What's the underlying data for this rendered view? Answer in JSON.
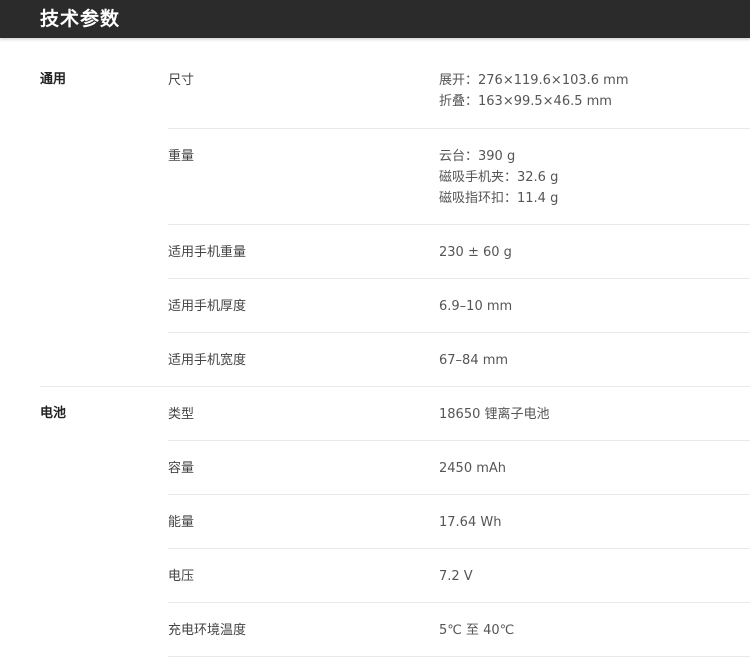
{
  "page_title": "技术参数",
  "sections": [
    {
      "label": "通用",
      "rows": [
        {
          "label": "尺寸",
          "values": [
            "展开：276×119.6×103.6 mm",
            "折叠：163×99.5×46.5 mm"
          ]
        },
        {
          "label": "重量",
          "values": [
            "云台：390 g",
            "磁吸手机夹：32.6 g",
            "磁吸指环扣：11.4 g"
          ]
        },
        {
          "label": "适用手机重量",
          "values": [
            "230 ± 60 g"
          ]
        },
        {
          "label": "适用手机厚度",
          "values": [
            "6.9–10 mm"
          ]
        },
        {
          "label": "适用手机宽度",
          "values": [
            "67–84 mm"
          ]
        }
      ]
    },
    {
      "label": "电池",
      "rows": [
        {
          "label": "类型",
          "values": [
            "18650 锂离子电池"
          ]
        },
        {
          "label": "容量",
          "values": [
            "2450 mAh"
          ]
        },
        {
          "label": "能量",
          "values": [
            "17.64 Wh"
          ]
        },
        {
          "label": "电压",
          "values": [
            "7.2 V"
          ]
        },
        {
          "label": "充电环境温度",
          "values": [
            "5℃ 至 40℃"
          ]
        }
      ]
    }
  ]
}
